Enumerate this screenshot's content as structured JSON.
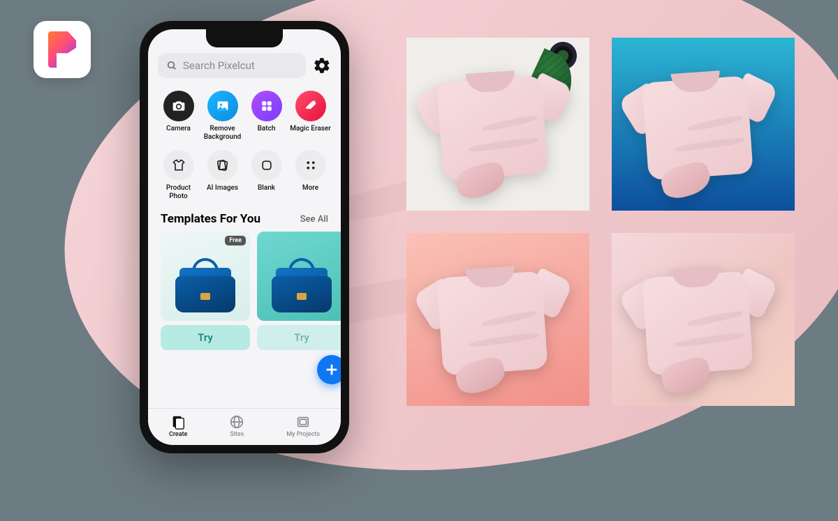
{
  "logo": {
    "alt": "Pixelcut"
  },
  "search": {
    "placeholder": "Search Pixelcut"
  },
  "tools": [
    {
      "label": "Camera",
      "icon": "camera-icon",
      "bg": "c-black"
    },
    {
      "label": "Remove Background",
      "icon": "image-icon",
      "bg": "c-blue"
    },
    {
      "label": "Batch",
      "icon": "grid-icon",
      "bg": "c-purple"
    },
    {
      "label": "Magic Eraser",
      "icon": "eraser-icon",
      "bg": "c-red"
    },
    {
      "label": "Product Photo",
      "icon": "tshirt-icon",
      "bg": "c-outline"
    },
    {
      "label": "AI Images",
      "icon": "cards-icon",
      "bg": "c-outline"
    },
    {
      "label": "Blank",
      "icon": "blank-icon",
      "bg": "c-outline"
    },
    {
      "label": "More",
      "icon": "more-icon",
      "bg": "c-outline"
    }
  ],
  "templates": {
    "title": "Templates For You",
    "see_all": "See All",
    "cards": [
      {
        "badge": "Free",
        "cta": "Try"
      },
      {
        "badge": "",
        "cta": "Try"
      }
    ]
  },
  "tabs": [
    {
      "label": "Create",
      "active": true
    },
    {
      "label": "Sites",
      "active": false
    },
    {
      "label": "My Projects",
      "active": false
    }
  ],
  "mockups": [
    "white-with-plant",
    "blue-gradient",
    "peach-gradient",
    "pink-marble"
  ]
}
